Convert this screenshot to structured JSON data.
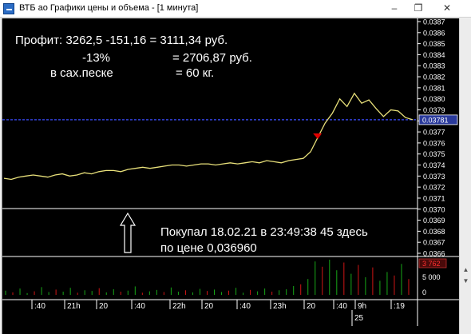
{
  "window": {
    "title": "ВТБ ао Графики цены и объема - [1 минута]",
    "min_glyph": "–",
    "max_glyph": "❐",
    "close_glyph": "✕",
    "scroll_up_glyph": "▲",
    "scroll_down_glyph": "▼"
  },
  "annotations": {
    "line1": "Профит: 3262,5  -151,16 =  3111,34 руб.",
    "line2": "-13%",
    "line2_value": "=  2706,87 руб.",
    "line3": "в сах.песке",
    "line3_value": "=  60 кг.",
    "note1": "Покупал 18.02.21 в 23:49:38 45 здесь",
    "note2": "по цене 0,036960"
  },
  "colors": {
    "background": "#000000",
    "price_line": "#e8e07a",
    "grid": "#ffffff",
    "current_price_line": "#3a4cff",
    "current_price_box": "#2a3a9c",
    "marker": "#e00000",
    "volume_up": "#17a817",
    "volume_down": "#d01515",
    "text": "#ffffff"
  },
  "chart_data": {
    "type": "line",
    "price_axis": {
      "ticks": [
        "0.0387",
        "0.0386",
        "0.0385",
        "0.0384",
        "0.0383",
        "0.0382",
        "0.0381",
        "0.0380",
        "0.0379",
        "0.0378",
        "0.0377",
        "0.0376",
        "0.0375",
        "0.0374",
        "0.0373",
        "0.0372",
        "0.0371",
        "0.0370",
        "0.0369",
        "0.0368",
        "0.0367",
        "0.0366"
      ],
      "ylim": [
        0.0366,
        0.0387
      ]
    },
    "current_price": 0.03781,
    "current_price_label": "0.03781",
    "series": [
      {
        "values": [
          0.03728,
          0.03727,
          0.03729,
          0.0373,
          0.03731,
          0.0373,
          0.03729,
          0.03731,
          0.03732,
          0.0373,
          0.03731,
          0.03733,
          0.03732,
          0.03734,
          0.03735,
          0.03735,
          0.03734,
          0.03736,
          0.03737,
          0.03738,
          0.03737,
          0.03738,
          0.03739,
          0.0374,
          0.0374,
          0.03739,
          0.0374,
          0.03741,
          0.03741,
          0.0374,
          0.03741,
          0.03742,
          0.03741,
          0.03742,
          0.03743,
          0.03742,
          0.03744,
          0.03743,
          0.03742,
          0.03744,
          0.03745,
          0.03746,
          0.03752,
          0.03765,
          0.03778,
          0.03787,
          0.038,
          0.03793,
          0.03805,
          0.03796,
          0.03799,
          0.03791,
          0.03784,
          0.0379,
          0.03789,
          0.03783,
          0.03781
        ]
      }
    ],
    "volume": {
      "axis_labels": [
        "3 762",
        "5 000",
        "0"
      ],
      "bars": [
        {
          "v": 0.12,
          "c": "up"
        },
        {
          "v": 0.07,
          "c": "down"
        },
        {
          "v": 0.18,
          "c": "up"
        },
        {
          "v": 0.05,
          "c": "up"
        },
        {
          "v": 0.1,
          "c": "down"
        },
        {
          "v": 0.22,
          "c": "up"
        },
        {
          "v": 0.08,
          "c": "up"
        },
        {
          "v": 0.15,
          "c": "down"
        },
        {
          "v": 0.09,
          "c": "up"
        },
        {
          "v": 0.2,
          "c": "up"
        },
        {
          "v": 0.06,
          "c": "down"
        },
        {
          "v": 0.13,
          "c": "up"
        },
        {
          "v": 0.11,
          "c": "up"
        },
        {
          "v": 0.19,
          "c": "down"
        },
        {
          "v": 0.07,
          "c": "up"
        },
        {
          "v": 0.16,
          "c": "up"
        },
        {
          "v": 0.09,
          "c": "down"
        },
        {
          "v": 0.12,
          "c": "up"
        },
        {
          "v": 0.24,
          "c": "up"
        },
        {
          "v": 0.06,
          "c": "down"
        },
        {
          "v": 0.1,
          "c": "up"
        },
        {
          "v": 0.14,
          "c": "up"
        },
        {
          "v": 0.08,
          "c": "down"
        },
        {
          "v": 0.21,
          "c": "up"
        },
        {
          "v": 0.09,
          "c": "up"
        },
        {
          "v": 0.13,
          "c": "down"
        },
        {
          "v": 0.07,
          "c": "up"
        },
        {
          "v": 0.17,
          "c": "up"
        },
        {
          "v": 0.11,
          "c": "down"
        },
        {
          "v": 0.15,
          "c": "up"
        },
        {
          "v": 0.08,
          "c": "up"
        },
        {
          "v": 0.12,
          "c": "down"
        },
        {
          "v": 0.2,
          "c": "up"
        },
        {
          "v": 0.06,
          "c": "up"
        },
        {
          "v": 0.14,
          "c": "down"
        },
        {
          "v": 0.1,
          "c": "up"
        },
        {
          "v": 0.18,
          "c": "up"
        },
        {
          "v": 0.09,
          "c": "down"
        },
        {
          "v": 0.13,
          "c": "up"
        },
        {
          "v": 0.16,
          "c": "up"
        },
        {
          "v": 0.25,
          "c": "up"
        },
        {
          "v": 0.3,
          "c": "down"
        },
        {
          "v": 0.45,
          "c": "up"
        },
        {
          "v": 0.95,
          "c": "up"
        },
        {
          "v": 0.8,
          "c": "down"
        },
        {
          "v": 1.0,
          "c": "up"
        },
        {
          "v": 0.7,
          "c": "up"
        },
        {
          "v": 0.92,
          "c": "down"
        },
        {
          "v": 0.6,
          "c": "up"
        },
        {
          "v": 0.85,
          "c": "down"
        },
        {
          "v": 0.5,
          "c": "up"
        },
        {
          "v": 0.78,
          "c": "down"
        },
        {
          "v": 0.4,
          "c": "up"
        },
        {
          "v": 0.65,
          "c": "up"
        },
        {
          "v": 0.55,
          "c": "down"
        },
        {
          "v": 0.88,
          "c": "up"
        },
        {
          "v": 0.45,
          "c": "down"
        }
      ]
    },
    "time_axis": [
      "40",
      "21h",
      "20",
      "40",
      "22h",
      "20",
      "40",
      "23h",
      "20",
      "40",
      "9h",
      "19"
    ],
    "date_label": "25"
  }
}
